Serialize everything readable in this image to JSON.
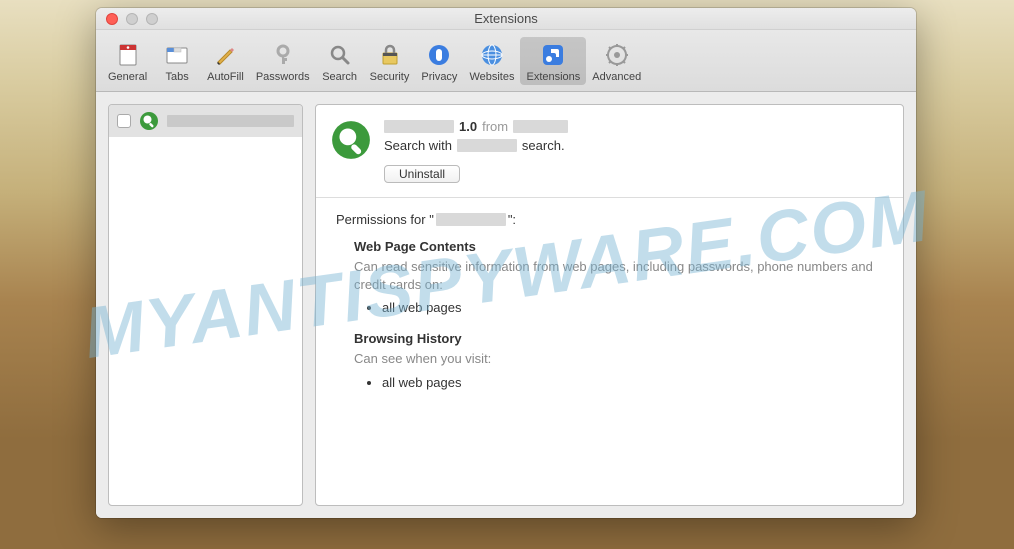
{
  "watermark": "MYANTISPYWARE.COM",
  "window": {
    "title": "Extensions"
  },
  "toolbar": {
    "items": [
      {
        "label": "General"
      },
      {
        "label": "Tabs"
      },
      {
        "label": "AutoFill"
      },
      {
        "label": "Passwords"
      },
      {
        "label": "Search"
      },
      {
        "label": "Security"
      },
      {
        "label": "Privacy"
      },
      {
        "label": "Websites"
      },
      {
        "label": "Extensions"
      },
      {
        "label": "Advanced"
      }
    ]
  },
  "ext_version": "1.0",
  "from_label": "from",
  "desc_prefix": "Search with",
  "desc_suffix": "search.",
  "uninstall_label": "Uninstall",
  "perms_prefix": "Permissions for \"",
  "perms_suffix": "\":",
  "perm1_heading": "Web Page Contents",
  "perm1_desc": "Can read sensitive information from web pages, including passwords, phone numbers and credit cards on:",
  "perm1_item": "all web pages",
  "perm2_heading": "Browsing History",
  "perm2_desc": "Can see when you visit:",
  "perm2_item": "all web pages"
}
